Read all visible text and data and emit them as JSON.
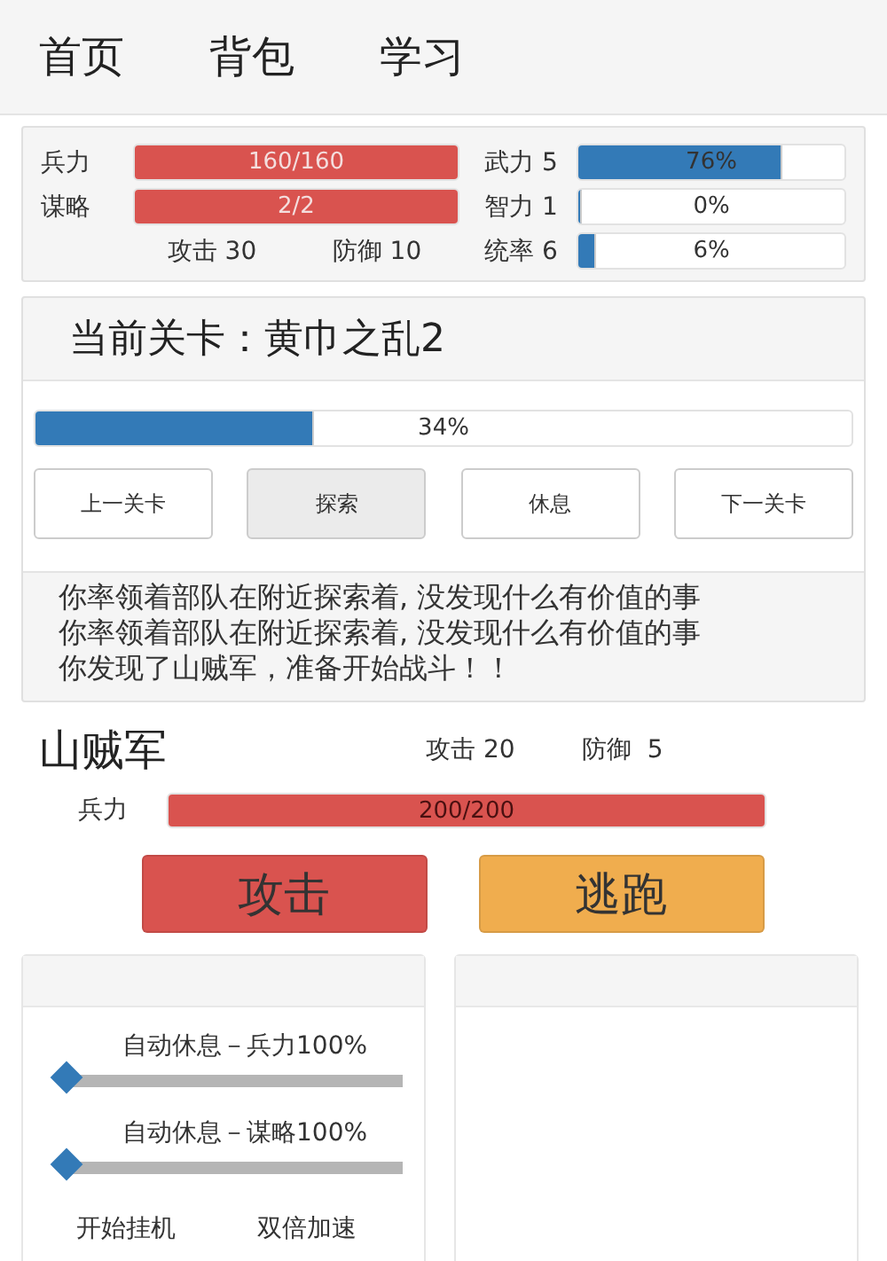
{
  "nav": [
    {
      "label": "首页"
    },
    {
      "label": "背包"
    },
    {
      "label": "学习"
    }
  ],
  "player": {
    "bars": [
      {
        "label": "兵力",
        "reading": "160/160",
        "level": 1
      },
      {
        "label": "谋略",
        "reading": "2/2",
        "level": 1
      }
    ],
    "attack": "攻击 30",
    "defense": "防御 10",
    "attributes": [
      {
        "label": "武力 5",
        "reading": "76%",
        "level": 0.76
      },
      {
        "label": "智力 1",
        "reading": "0%",
        "level": 0
      },
      {
        "label": "统率 6",
        "reading": "6%",
        "level": 0.06
      }
    ]
  },
  "stage": {
    "title": "当前关卡：黄巾之乱2",
    "progress": {
      "reading": "34%",
      "level": 0.34
    },
    "buttons": [
      {
        "label": "上一关卡",
        "pressed": false
      },
      {
        "label": "探索",
        "pressed": true
      },
      {
        "label": "休息",
        "pressed": false
      },
      {
        "label": "下一关卡",
        "pressed": false
      }
    ],
    "log": [
      "你率领着部队在附近探索着, 没发现什么有价值的事",
      "你率领着部队在附近探索着, 没发现什么有价值的事",
      "你发现了山贼军，准备开始战斗！！"
    ]
  },
  "enemy": {
    "name": "山贼军",
    "attack": "攻击 20",
    "defense": "防御  5",
    "bar": {
      "label": "兵力",
      "reading": "200/200",
      "level": 1
    }
  },
  "actions": [
    {
      "label": "攻击",
      "kind": "attack"
    },
    {
      "label": "逃跑",
      "kind": "flee"
    }
  ],
  "settings": {
    "sliders": [
      {
        "label": "自动休息－兵力100%",
        "level": 0
      },
      {
        "label": "自动休息－谋略100%",
        "level": 0
      }
    ],
    "toggles": [
      {
        "label": "开始挂机"
      },
      {
        "label": "双倍加速"
      }
    ]
  }
}
